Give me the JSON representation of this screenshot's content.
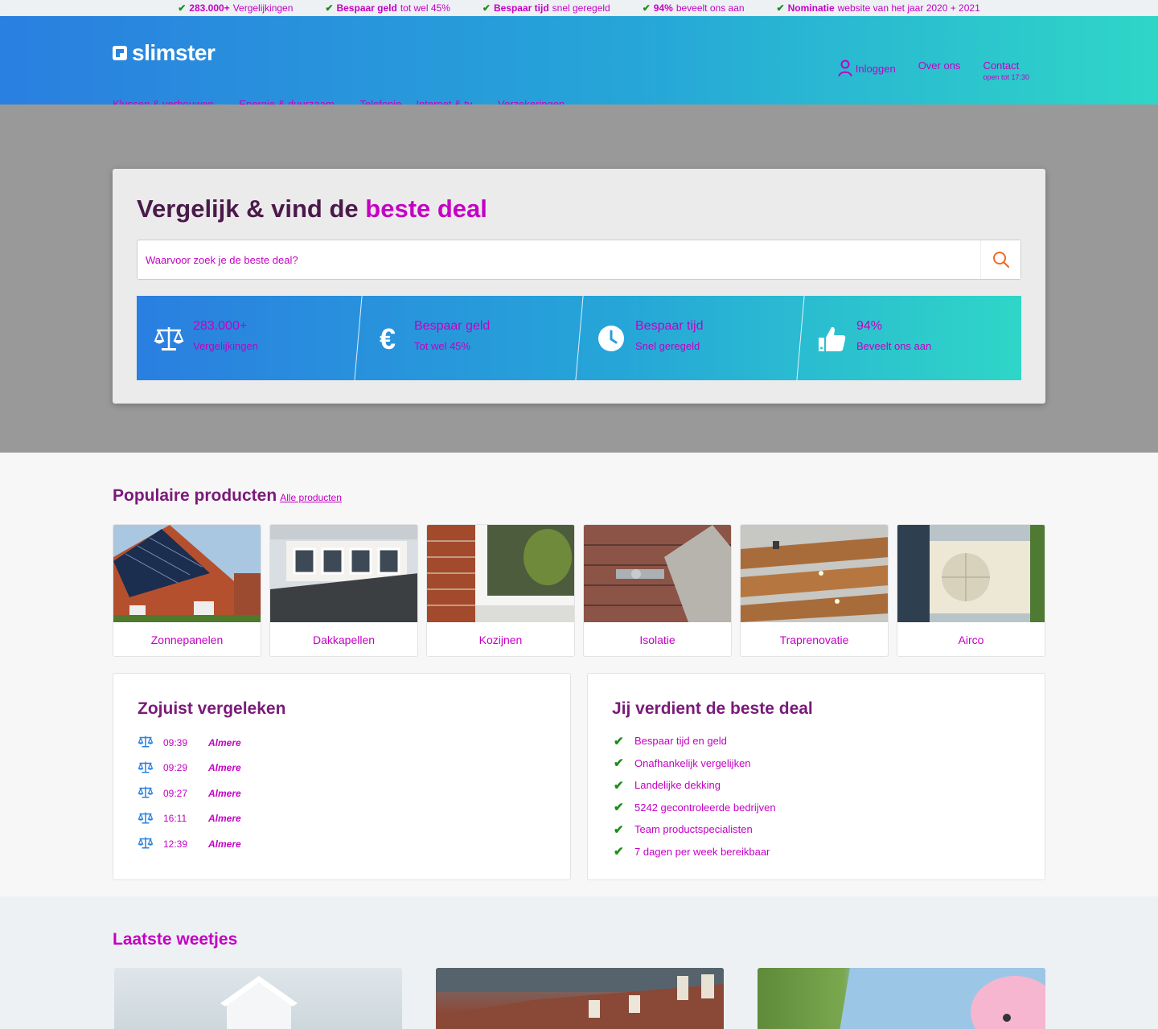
{
  "usp_bar": [
    {
      "bold": "283.000+",
      "text": "Vergelijkingen"
    },
    {
      "bold": "Bespaar geld",
      "text": "tot wel 45%"
    },
    {
      "bold": "Bespaar tijd",
      "text": "snel geregeld"
    },
    {
      "bold": "94%",
      "text": "beveelt ons aan"
    },
    {
      "bold": "Nominatie",
      "text": "website van het jaar 2020 + 2021"
    }
  ],
  "header": {
    "logo": "slimster",
    "login": "Inloggen",
    "about": "Over ons",
    "contact": "Contact",
    "contact_hours": "open tot 17:30"
  },
  "nav": [
    {
      "label": "Klussen & verbouwen",
      "dropdown": true
    },
    {
      "label": "Energie & duurzaam",
      "dropdown": true
    },
    {
      "label": "Telefonie",
      "dropdown": false
    },
    {
      "label": "Internet & tv",
      "dropdown": true
    },
    {
      "label": "Verzekeringen",
      "dropdown": false
    }
  ],
  "hero": {
    "title_plain": "Vergelijk & vind de ",
    "title_accent": "beste deal",
    "search_placeholder": "Waarvoor zoek je de beste deal?",
    "stats": [
      {
        "icon": "scale-icon",
        "title": "283.000+",
        "sub": "Vergelijkingen"
      },
      {
        "icon": "euro-icon",
        "title": "Bespaar geld",
        "sub": "Tot wel 45%"
      },
      {
        "icon": "clock-icon",
        "title": "Bespaar tijd",
        "sub": "Snel geregeld"
      },
      {
        "icon": "thumbs-up-icon",
        "title": "94%",
        "sub": "Beveelt ons aan"
      }
    ]
  },
  "popular": {
    "title": "Populaire producten",
    "all_link": "Alle producten",
    "products": [
      {
        "label": "Zonnepanelen"
      },
      {
        "label": "Dakkapellen"
      },
      {
        "label": "Kozijnen"
      },
      {
        "label": "Isolatie"
      },
      {
        "label": "Traprenovatie"
      },
      {
        "label": "Airco"
      }
    ]
  },
  "recent": {
    "title": "Zojuist vergeleken",
    "items": [
      {
        "time": "09:39",
        "city": "Almere"
      },
      {
        "time": "09:29",
        "city": "Almere"
      },
      {
        "time": "09:27",
        "city": "Almere"
      },
      {
        "time": "16:11",
        "city": "Almere"
      },
      {
        "time": "12:39",
        "city": "Almere"
      }
    ]
  },
  "benefits": {
    "title": "Jij verdient de beste deal",
    "items": [
      "Bespaar tijd en geld",
      "Onafhankelijk vergelijken",
      "Landelijke dekking",
      "5242 gecontroleerde bedrijven",
      "Team productspecialisten",
      "7 dagen per week bereikbaar"
    ]
  },
  "blog": {
    "title": "Laatste weetjes"
  },
  "colors": {
    "accent": "#c400c4",
    "gradient_start": "#2a7fe0",
    "gradient_end": "#2fd6c7",
    "check_green": "#1a8f1a",
    "search_orange": "#f26a21"
  }
}
